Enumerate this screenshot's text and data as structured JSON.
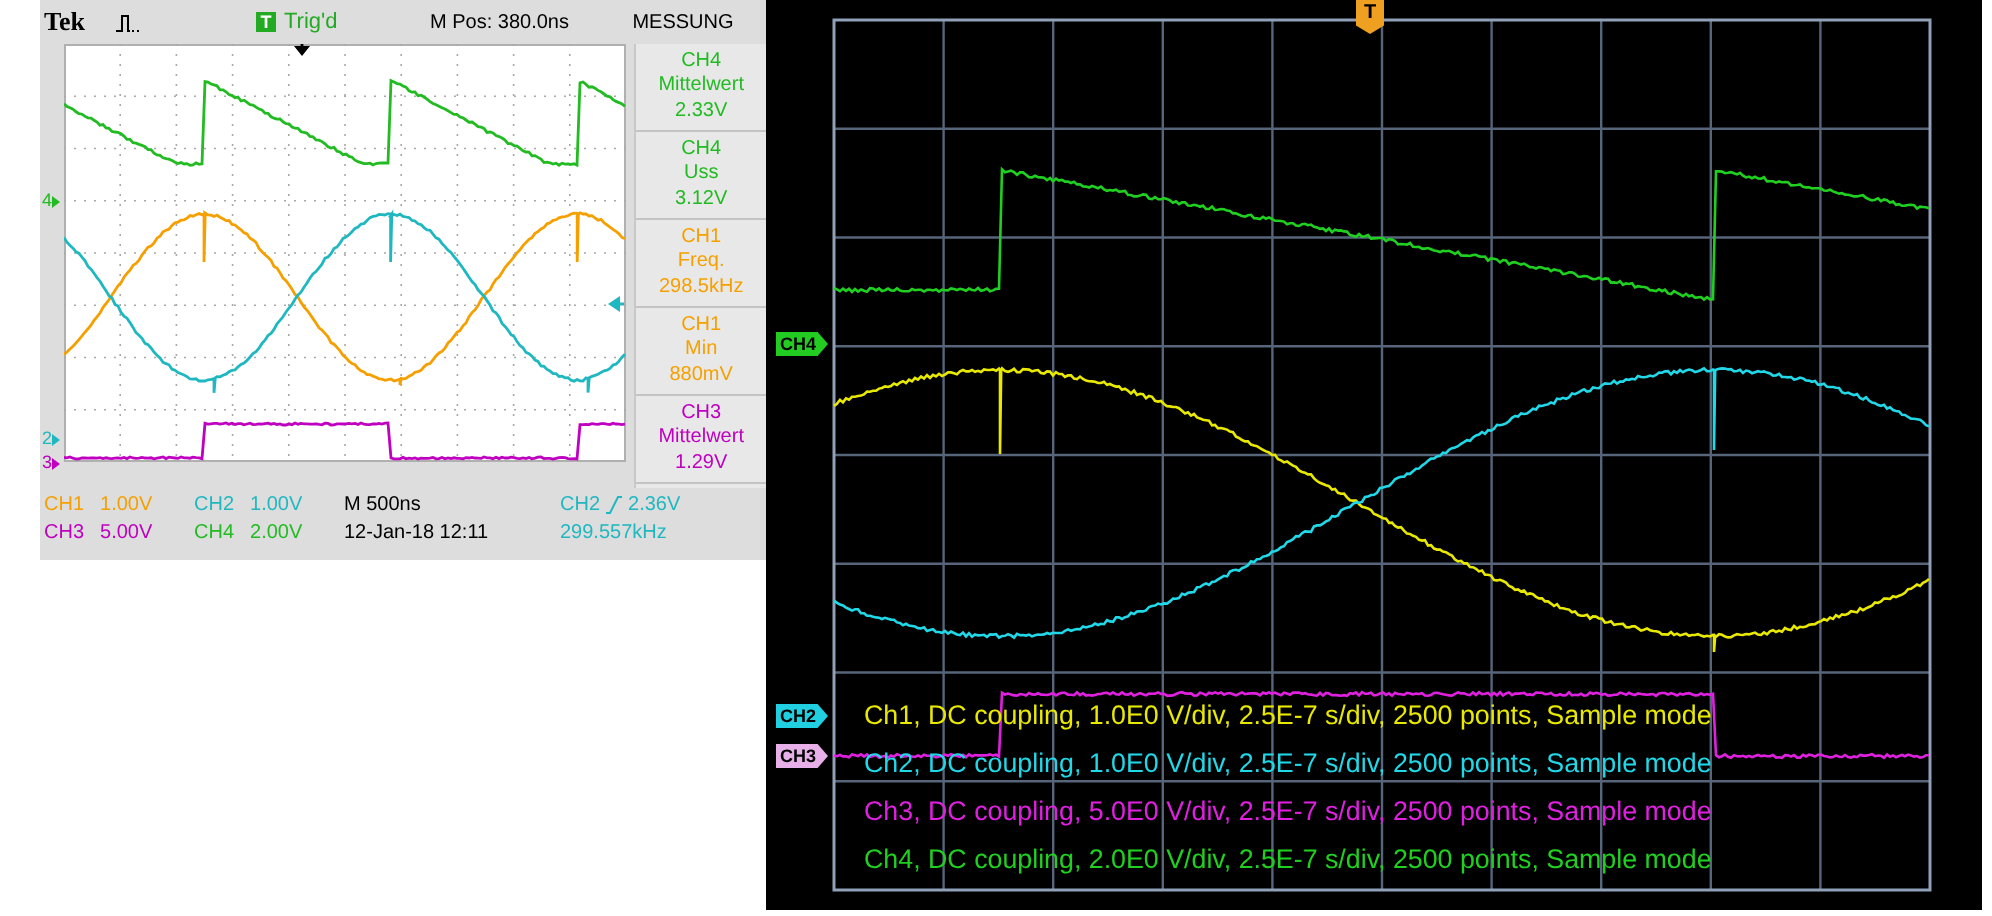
{
  "left_scope": {
    "brand": "Tek",
    "trigger_badge": "T",
    "trigger_status": "Trig'd",
    "position": "M Pos: 380.0ns",
    "menu_title": "MESSUNG",
    "measurements": [
      {
        "channel": "CH4",
        "label": "Mittelwert",
        "value": "2.33V",
        "color": "#22bb22"
      },
      {
        "channel": "CH4",
        "label": "Uss",
        "value": "3.12V",
        "color": "#22bb22"
      },
      {
        "channel": "CH1",
        "label": "Freq.",
        "value": "298.5kHz",
        "color": "#f5a000"
      },
      {
        "channel": "CH1",
        "label": "Min",
        "value": "880mV",
        "color": "#f5a000"
      },
      {
        "channel": "CH3",
        "label": "Mittelwert",
        "value": "1.29V",
        "color": "#c000c0"
      }
    ],
    "markers": [
      {
        "label": "4",
        "color": "#22bb22"
      },
      {
        "label": "2",
        "color": "#20b8c0"
      },
      {
        "label": "3",
        "color": "#c000c0"
      }
    ],
    "scales": [
      {
        "channel": "CH1",
        "value": "1.00V",
        "color": "#f5a000"
      },
      {
        "channel": "CH2",
        "value": "1.00V",
        "color": "#20b8c0"
      },
      {
        "channel": "CH3",
        "value": "5.00V",
        "color": "#c000c0"
      },
      {
        "channel": "CH4",
        "value": "2.00V",
        "color": "#22bb22"
      }
    ],
    "timebase": "M 500ns",
    "datetime": "12-Jan-18 12:11",
    "trigger_source": "CH2",
    "trigger_level": "2.36V",
    "frequency": "299.557kHz"
  },
  "right_scope": {
    "trigger_marker": "T",
    "channel_tags": [
      {
        "label": "CH4",
        "color": "#22cc22"
      },
      {
        "label": "CH2",
        "color": "#20d0e0"
      },
      {
        "label": "CH3",
        "color": "#e8b0e8"
      }
    ],
    "legend": [
      {
        "text": "Ch1, DC coupling, 1.0E0 V/div, 2.5E-7 s/div, 2500 points, Sample mode",
        "color": "#e8e800"
      },
      {
        "text": "Ch2, DC coupling, 1.0E0 V/div, 2.5E-7 s/div, 2500 points, Sample mode",
        "color": "#20d8e8"
      },
      {
        "text": "Ch3, DC coupling, 5.0E0 V/div, 2.5E-7 s/div, 2500 points, Sample mode",
        "color": "#e020e0"
      },
      {
        "text": "Ch4, DC coupling, 2.0E0 V/div, 2.5E-7 s/div, 2500 points, Sample mode",
        "color": "#20d020"
      }
    ]
  }
}
